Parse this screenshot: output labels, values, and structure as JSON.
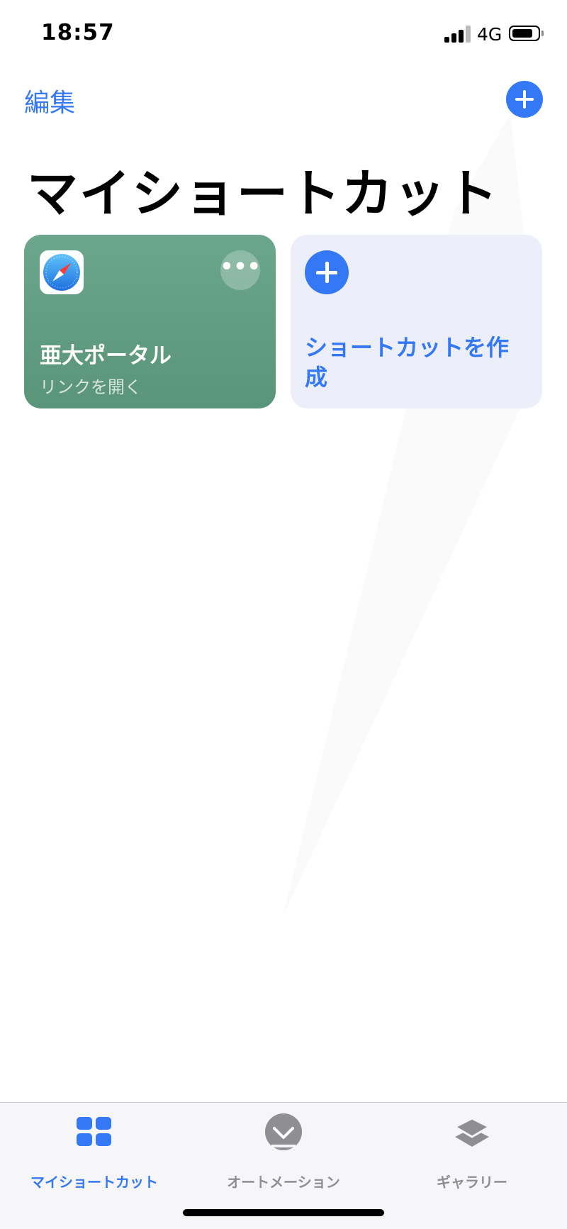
{
  "status_bar": {
    "time": "18:57",
    "network": "4G",
    "icons": [
      "signal-icon",
      "battery-icon"
    ]
  },
  "nav": {
    "edit_label": "編集",
    "add_icon": "plus-icon"
  },
  "page_title": "マイショートカット",
  "shortcuts": [
    {
      "title": "亜大ポータル",
      "subtitle": "リンクを開く",
      "icon": "safari-icon",
      "color": "#63a086"
    }
  ],
  "create_card": {
    "label": "ショートカットを作成",
    "icon": "plus-icon"
  },
  "tab_bar": {
    "tabs": [
      {
        "label": "マイショートカット",
        "icon": "grid-icon",
        "active": true
      },
      {
        "label": "オートメーション",
        "icon": "checkmark-circle-icon",
        "active": false
      },
      {
        "label": "ギャラリー",
        "icon": "layers-icon",
        "active": false
      }
    ]
  },
  "colors": {
    "accent": "#3478f6",
    "inactive": "#8e8e93",
    "card_green": "#63a086",
    "card_create": "#eceff9"
  }
}
